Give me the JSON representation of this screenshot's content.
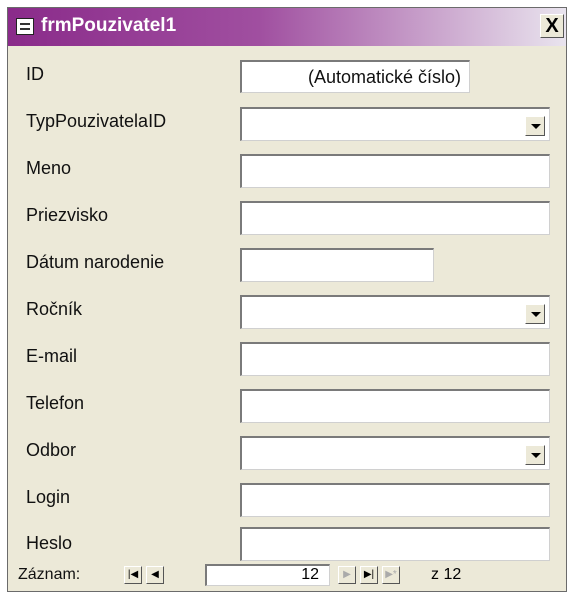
{
  "window": {
    "title": "frmPouzivatel1",
    "close_label": "X"
  },
  "fields": [
    {
      "label": "ID",
      "value": "(Automatické číslo)",
      "type": "auto"
    },
    {
      "label": "TypPouzivatelaID",
      "value": "",
      "type": "combo"
    },
    {
      "label": "Meno",
      "value": "",
      "type": "text"
    },
    {
      "label": "Priezvisko",
      "value": "",
      "type": "text"
    },
    {
      "label": "Dátum narodenie",
      "value": "",
      "type": "short"
    },
    {
      "label": "Ročník",
      "value": "",
      "type": "combo"
    },
    {
      "label": "E-mail",
      "value": "",
      "type": "text"
    },
    {
      "label": "Telefon",
      "value": "",
      "type": "text"
    },
    {
      "label": "Odbor",
      "value": "",
      "type": "combo"
    },
    {
      "label": "Login",
      "value": "",
      "type": "text"
    },
    {
      "label": "Heslo",
      "value": "",
      "type": "text"
    }
  ],
  "nav": {
    "label": "Záznam:",
    "first": "|◀",
    "prev": "◀",
    "next": "▶",
    "last": "▶|",
    "new": "▶*",
    "current": "12",
    "of_label": "z",
    "total": "12"
  }
}
